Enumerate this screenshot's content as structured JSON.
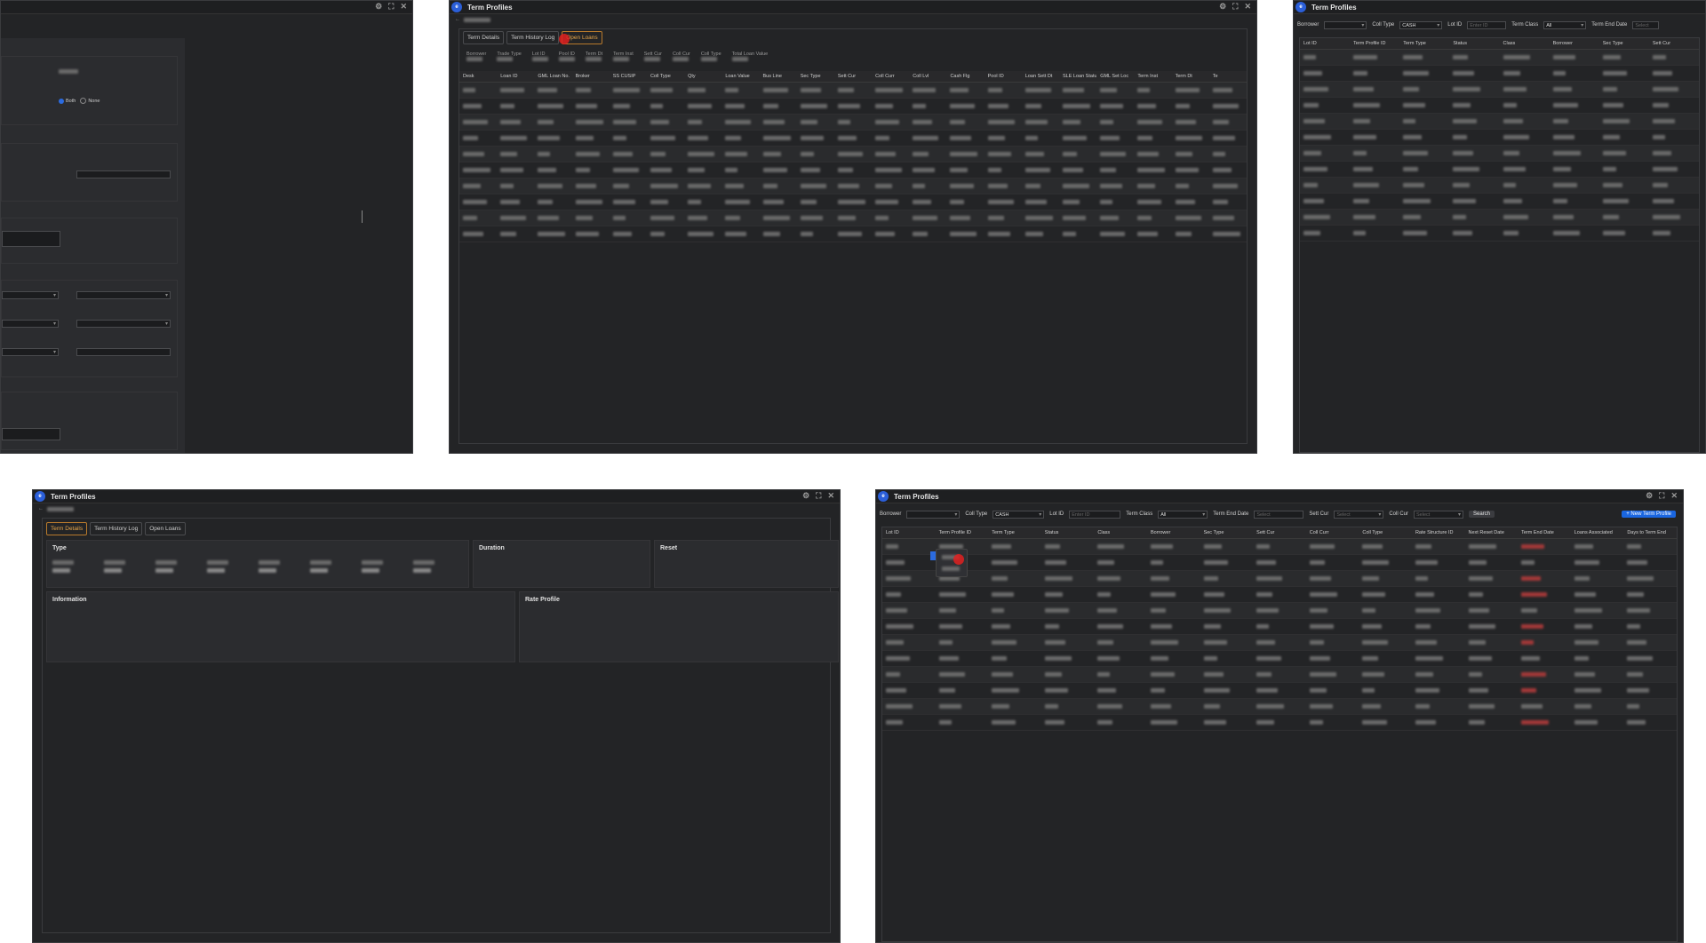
{
  "app": {
    "title": "Term Profiles"
  },
  "window_controls": [
    "gear-icon",
    "expand-icon",
    "close-icon"
  ],
  "detail": {
    "back_label": "←",
    "tabs": [
      {
        "label": "Term Details"
      },
      {
        "label": "Term History Log"
      },
      {
        "label": "Open Loans"
      }
    ],
    "sections": {
      "type": "Type",
      "duration": "Duration",
      "reset": "Reset",
      "information": "Information",
      "rate_profile": "Rate Profile"
    },
    "radio_labels": [
      "Both",
      "None"
    ]
  },
  "open_loans": {
    "summary_labels": [
      "Borrower",
      "Trade Type",
      "Lot ID",
      "Pool ID",
      "Term Dt",
      "Term Inst",
      "Sett Cur",
      "Coll Cur",
      "Coll Type",
      "Total Loan Value"
    ],
    "columns": [
      "Desk",
      "Loan ID",
      "GML Loan No.",
      "Broker",
      "SS CUSIP",
      "Coll Type",
      "Qty",
      "Loan Value",
      "Bus Line",
      "Sec Type",
      "Sett Cur",
      "Coll Curr",
      "Coll Lvl",
      "Cash Flg",
      "Pool ID",
      "Loan Sett Dt",
      "SLE Loan Status",
      "GML Set Loc",
      "Term Inst",
      "Term Dt",
      "Te"
    ]
  },
  "list": {
    "filters": {
      "borrower_label": "Borrower",
      "coll_type_label": "Coll Type",
      "coll_type_value": "CASH",
      "lot_id_label": "Lot ID",
      "lot_id_placeholder": "Enter ID",
      "term_class_label": "Term Class",
      "term_class_value": "All",
      "term_end_date_label": "Term End Date",
      "term_end_date_placeholder": "Select",
      "sett_cur_label": "Sett Cur",
      "sett_cur_placeholder": "Select",
      "coll_cur_label": "Coll Cur",
      "coll_cur_placeholder": "Select",
      "search_label": "Search",
      "new_button_label": "+ New Term Profile"
    },
    "columns": [
      "Lot ID",
      "Term Profile ID",
      "Term Type",
      "Status",
      "Class",
      "Borrower",
      "Sec Type",
      "Sett Cur",
      "Coll Curr",
      "Coll Type",
      "Rate Structure ID",
      "Next Reset Date",
      "Term End Date",
      "Loans Associated",
      "Days to Term End"
    ],
    "mini_columns": [
      "Lot ID",
      "Term Profile ID",
      "Term Type",
      "Status",
      "Class",
      "Borrower",
      "Sec Type",
      "Sett Cur"
    ]
  },
  "colors": {
    "accent": "#1a66e0",
    "active_tab": "#e6a64a",
    "highlight": "#e02020",
    "bg": "#232426"
  }
}
